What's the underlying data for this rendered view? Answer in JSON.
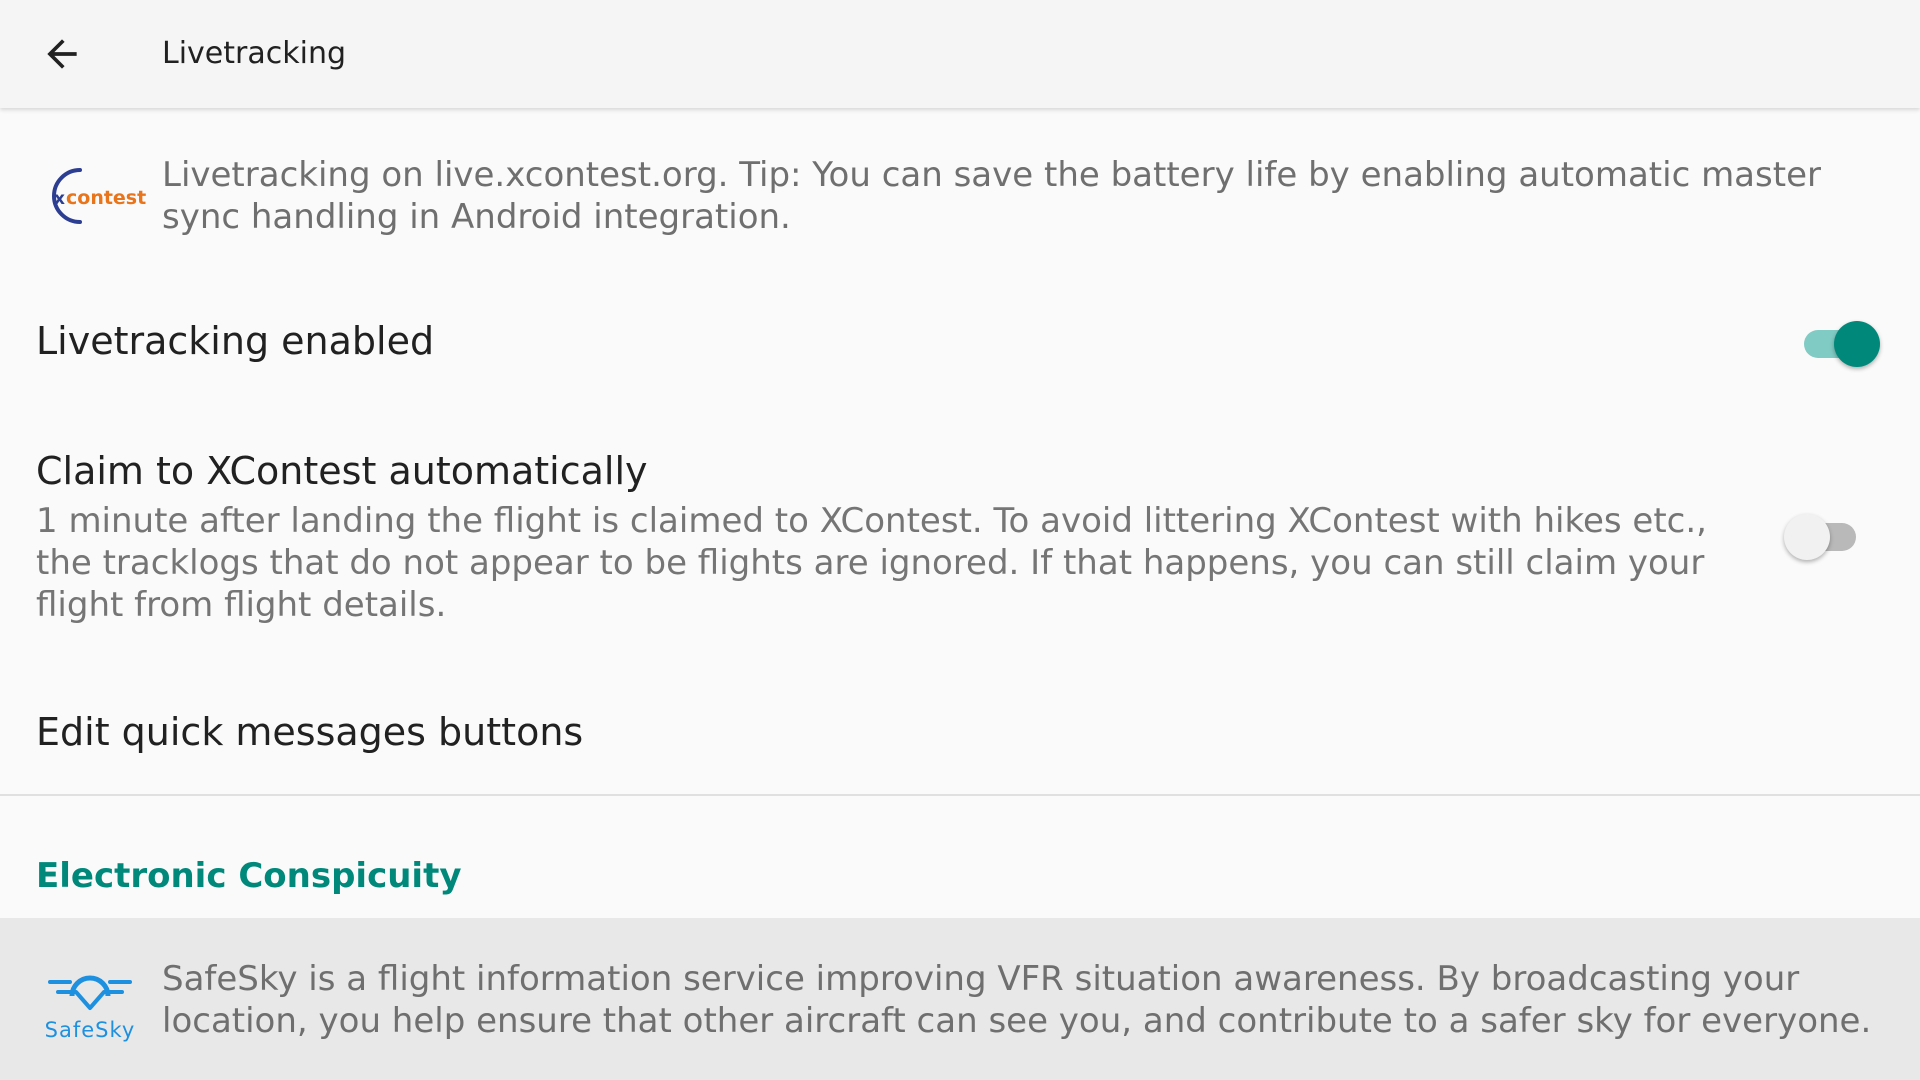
{
  "appbar": {
    "title": "Livetracking",
    "back_icon": "arrow-left-icon"
  },
  "xcontest_info": {
    "logo_text_prefix": "x",
    "logo_text_main": "contest",
    "text": "Livetracking on live.xcontest.org. Tip: You can save the battery life by enabling automatic master sync handling in Android integration."
  },
  "prefs": {
    "livetracking_enabled": {
      "title": "Livetracking enabled",
      "checked": true
    },
    "claim_xcontest": {
      "title": "Claim to XContest automatically",
      "summary": "1 minute after landing the flight is claimed to XContest. To avoid littering XContest with hikes etc., the tracklogs that do not appear to be flights are ignored. If that happens, you can still claim your flight from flight details.",
      "checked": false
    },
    "quick_messages": {
      "title": "Edit quick messages buttons"
    }
  },
  "category": {
    "title": "Electronic Conspicuity"
  },
  "safesky": {
    "logo_label": "SafeSky",
    "text": "SafeSky is a flight information service improving VFR situation awareness. By broadcasting your location, you help ensure that other aircraft can see you, and contribute to a safer sky for everyone."
  },
  "colors": {
    "accent": "#00897b",
    "accent_light": "#80cbc4",
    "xcontest_blue": "#2c3e91",
    "xcontest_orange": "#e8741c",
    "safesky_blue": "#1e90e0"
  }
}
